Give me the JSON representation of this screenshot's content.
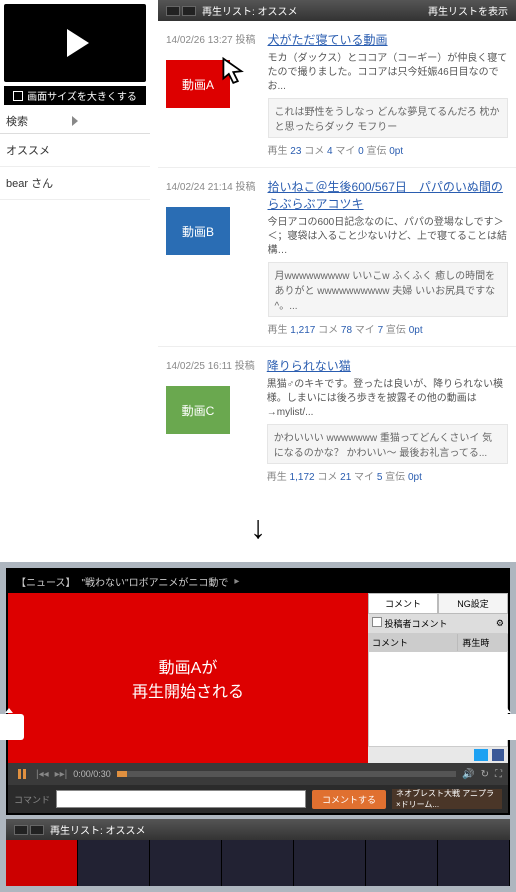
{
  "top": {
    "resize_label": "画面サイズを大きくする",
    "search_label": "検索",
    "side_items": [
      "オススメ",
      "bear さん"
    ],
    "list_header_title": "再生リスト: オススメ",
    "list_header_action": "再生リストを表示"
  },
  "videos": [
    {
      "date": "14/02/26 13:27 投稿",
      "thumb_label": "動画A",
      "thumb_color": "red",
      "title": "犬がただ寝ている動画",
      "desc": "モカ（ダックス）とココア（コーギー）が仲良く寝てたので撮りました。ココアは只今妊娠46日目なのでお...",
      "quote": "これは野性をうしなっ どんな夢見てるんだろ 枕かと思ったらダック モフりー",
      "stats": {
        "play": "23",
        "comment": "4",
        "mylist": "0",
        "ad": "0pt"
      }
    },
    {
      "date": "14/02/24 21:14 投稿",
      "thumb_label": "動画B",
      "thumb_color": "blue",
      "title": "拾いねこ＠生後600/567日　パパのいぬ間のらぶらぶアコツキ",
      "desc": "今日アコの600日記念なのに、パパの登場なしです＞＜；寝袋は入ること少ないけど、上で寝てることは結構…",
      "quote": "月wwwwwwwww いいこw ふくふく 癒しの時間をありがと wwwwwwwwww 夫婦 いいお尻具ですな^。...",
      "stats": {
        "play": "1,217",
        "comment": "78",
        "mylist": "7",
        "ad": "0pt"
      }
    },
    {
      "date": "14/02/25 16:11 投稿",
      "thumb_label": "動画C",
      "thumb_color": "green",
      "title": "降りられない猫",
      "desc": "黒猫♂のキキです。登ったは良いが、降りられない模様。しまいには後ろ歩きを披露その他の動画は→mylist/...",
      "quote": "かわいいい wwwwwww 重猫ってどんくさいイ 気になるのかな？ かわいい〜 最後お礼言ってる...",
      "stats": {
        "play": "1,172",
        "comment": "21",
        "mylist": "5",
        "ad": "0pt"
      }
    }
  ],
  "arrow": "↓",
  "player": {
    "titlebar_tag": "【ニュース】",
    "titlebar_text": "\"戦わない\"ロボアニメがニコ動で",
    "overlay_line1": "動画Aが",
    "overlay_line2": "再生開始される",
    "time": "0:00/0:30",
    "side": {
      "tab_comment": "コメント",
      "tab_ng": "NG設定",
      "contributor_label": "投稿者コメント",
      "col_comment": "コメント",
      "col_play": "再生時"
    },
    "input_placeholder": "コマンド",
    "post_label": "コメントする",
    "ad_text": "ネオブレスト大戦 アニプラ×ドリーム..."
  },
  "bottom_strip": {
    "title": "再生リスト: オススメ"
  },
  "stat_labels": {
    "play": "再生",
    "comment": "コメ",
    "mylist": "マイ",
    "ad": "宣伝"
  }
}
